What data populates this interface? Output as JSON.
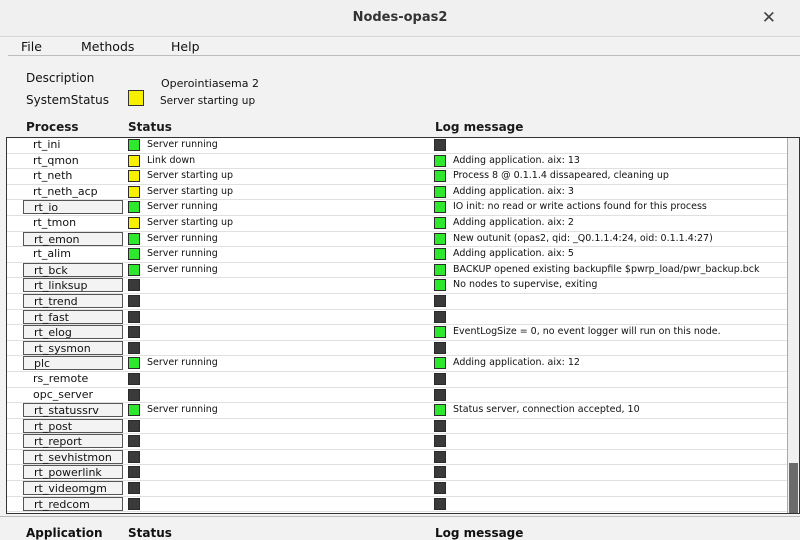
{
  "window": {
    "title": "Nodes-opas2",
    "close_glyph": "✕"
  },
  "menu": {
    "file": "File",
    "methods": "Methods",
    "help": "Help"
  },
  "info": {
    "description_label": "Description",
    "description_value": "Operointiasema 2",
    "status_label": "SystemStatus",
    "status_value": "Server starting up",
    "status_color": "#f7f000"
  },
  "colors": {
    "green": "#2ee82e",
    "yellow": "#f7f000",
    "dark": "#3a3a3a"
  },
  "columns": {
    "process": "Process",
    "status": "Status",
    "log": "Log message"
  },
  "rows": [
    {
      "name": "rt_ini",
      "button": false,
      "status_color": "green",
      "status_text": "Server running",
      "log_color": "dark",
      "log_text": ""
    },
    {
      "name": "rt_qmon",
      "button": false,
      "status_color": "yellow",
      "status_text": "Link down",
      "log_color": "green",
      "log_text": "Adding application. aix: 13"
    },
    {
      "name": "rt_neth",
      "button": false,
      "status_color": "yellow",
      "status_text": "Server starting up",
      "log_color": "green",
      "log_text": "Process 8 @ 0.1.1.4 dissapeared, cleaning up"
    },
    {
      "name": "rt_neth_acp",
      "button": false,
      "status_color": "yellow",
      "status_text": "Server starting up",
      "log_color": "green",
      "log_text": "Adding application. aix: 3"
    },
    {
      "name": "rt_io",
      "button": true,
      "status_color": "green",
      "status_text": "Server running",
      "log_color": "green",
      "log_text": "IO init: no read or write actions found for this process"
    },
    {
      "name": "rt_tmon",
      "button": false,
      "status_color": "yellow",
      "status_text": "Server starting up",
      "log_color": "green",
      "log_text": "Adding application. aix: 2"
    },
    {
      "name": "rt_emon",
      "button": true,
      "status_color": "green",
      "status_text": "Server running",
      "log_color": "green",
      "log_text": "New outunit (opas2, qid: _Q0.1.1.4:24, oid: 0.1.1.4:27)"
    },
    {
      "name": "rt_alim",
      "button": false,
      "status_color": "green",
      "status_text": "Server running",
      "log_color": "green",
      "log_text": "Adding application. aix: 5"
    },
    {
      "name": "rt_bck",
      "button": true,
      "status_color": "green",
      "status_text": "Server running",
      "log_color": "green",
      "log_text": "BACKUP opened existing backupfile $pwrp_load/pwr_backup.bck"
    },
    {
      "name": "rt_linksup",
      "button": true,
      "status_color": "dark",
      "status_text": "",
      "log_color": "green",
      "log_text": "No nodes to supervise, exiting"
    },
    {
      "name": "rt_trend",
      "button": true,
      "status_color": "dark",
      "status_text": "",
      "log_color": "dark",
      "log_text": ""
    },
    {
      "name": "rt_fast",
      "button": true,
      "status_color": "dark",
      "status_text": "",
      "log_color": "dark",
      "log_text": ""
    },
    {
      "name": "rt_elog",
      "button": true,
      "status_color": "dark",
      "status_text": "",
      "log_color": "green",
      "log_text": "EventLogSize = 0, no event logger will run on this node."
    },
    {
      "name": "rt_sysmon",
      "button": true,
      "status_color": "dark",
      "status_text": "",
      "log_color": "dark",
      "log_text": ""
    },
    {
      "name": "plc",
      "button": true,
      "status_color": "green",
      "status_text": "Server running",
      "log_color": "green",
      "log_text": "Adding application. aix: 12"
    },
    {
      "name": "rs_remote",
      "button": false,
      "status_color": "dark",
      "status_text": "",
      "log_color": "dark",
      "log_text": ""
    },
    {
      "name": "opc_server",
      "button": false,
      "status_color": "dark",
      "status_text": "",
      "log_color": "dark",
      "log_text": ""
    },
    {
      "name": "rt_statussrv",
      "button": true,
      "status_color": "green",
      "status_text": "Server running",
      "log_color": "green",
      "log_text": "Status server, connection accepted, 10"
    },
    {
      "name": "rt_post",
      "button": true,
      "status_color": "dark",
      "status_text": "",
      "log_color": "dark",
      "log_text": ""
    },
    {
      "name": "rt_report",
      "button": true,
      "status_color": "dark",
      "status_text": "",
      "log_color": "dark",
      "log_text": ""
    },
    {
      "name": "rt_sevhistmon",
      "button": true,
      "status_color": "dark",
      "status_text": "",
      "log_color": "dark",
      "log_text": ""
    },
    {
      "name": "rt_powerlink",
      "button": true,
      "status_color": "dark",
      "status_text": "",
      "log_color": "dark",
      "log_text": ""
    },
    {
      "name": "rt_videomgm",
      "button": true,
      "status_color": "dark",
      "status_text": "",
      "log_color": "dark",
      "log_text": ""
    },
    {
      "name": "rt_redcom",
      "button": true,
      "status_color": "dark",
      "status_text": "",
      "log_color": "dark",
      "log_text": ""
    }
  ],
  "bottom_columns": {
    "application": "Application",
    "status": "Status",
    "log": "Log message"
  }
}
